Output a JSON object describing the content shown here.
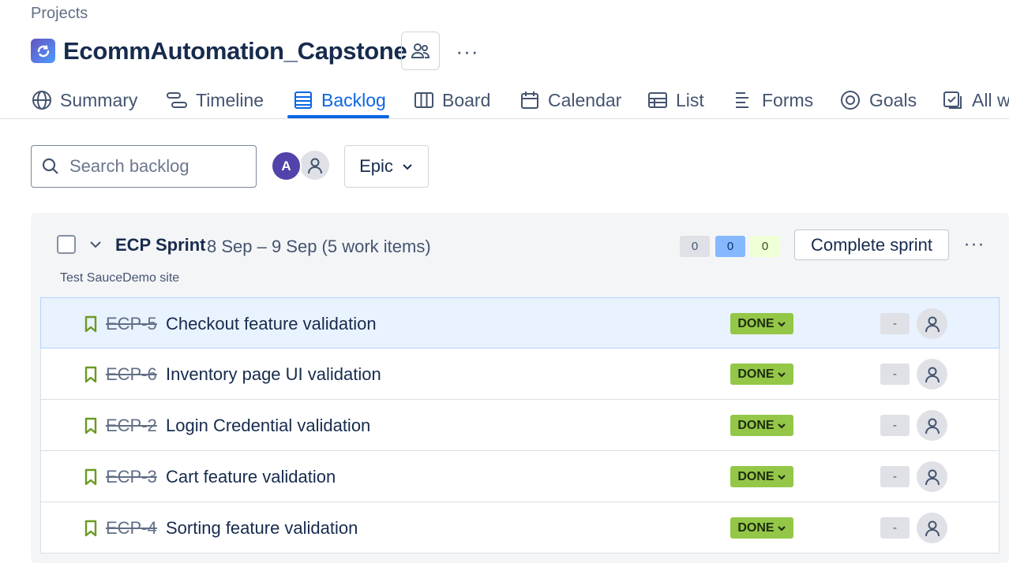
{
  "breadcrumb": "Projects",
  "project": {
    "title": "EcommAutomation_Capstone",
    "more": "···"
  },
  "tabs": [
    {
      "label": "Summary",
      "icon": "globe-icon"
    },
    {
      "label": "Timeline",
      "icon": "timeline-icon"
    },
    {
      "label": "Backlog",
      "icon": "backlog-icon",
      "active": true
    },
    {
      "label": "Board",
      "icon": "board-icon"
    },
    {
      "label": "Calendar",
      "icon": "calendar-icon"
    },
    {
      "label": "List",
      "icon": "list-icon"
    },
    {
      "label": "Forms",
      "icon": "forms-icon"
    },
    {
      "label": "Goals",
      "icon": "goals-icon"
    },
    {
      "label": "All w",
      "icon": "all-work-icon"
    }
  ],
  "search": {
    "placeholder": "Search backlog"
  },
  "avatars": {
    "user_initial": "A"
  },
  "filter": {
    "epic_label": "Epic"
  },
  "sprint": {
    "name": "ECP Sprint",
    "meta": "8 Sep – 9 Sep (5 work items)",
    "goal": "Test SauceDemo site",
    "counts": {
      "todo": "0",
      "in_progress": "0",
      "done": "0"
    },
    "complete_label": "Complete sprint",
    "more": "···"
  },
  "colors": {
    "accent": "#0c66e4",
    "done_lozenge": "#94c748",
    "story_icon": "#6a9a23",
    "selected_row": "#e9f2ff"
  },
  "issues": [
    {
      "key": "ECP-5",
      "summary": "Checkout feature validation",
      "status": "DONE",
      "estimate": "-",
      "selected": true
    },
    {
      "key": "ECP-6",
      "summary": "Inventory page UI validation",
      "status": "DONE",
      "estimate": "-"
    },
    {
      "key": "ECP-2",
      "summary": "Login Credential validation",
      "status": "DONE",
      "estimate": "-"
    },
    {
      "key": "ECP-3",
      "summary": "Cart feature validation",
      "status": "DONE",
      "estimate": "-"
    },
    {
      "key": "ECP-4",
      "summary": "Sorting feature validation",
      "status": "DONE",
      "estimate": "-"
    }
  ]
}
